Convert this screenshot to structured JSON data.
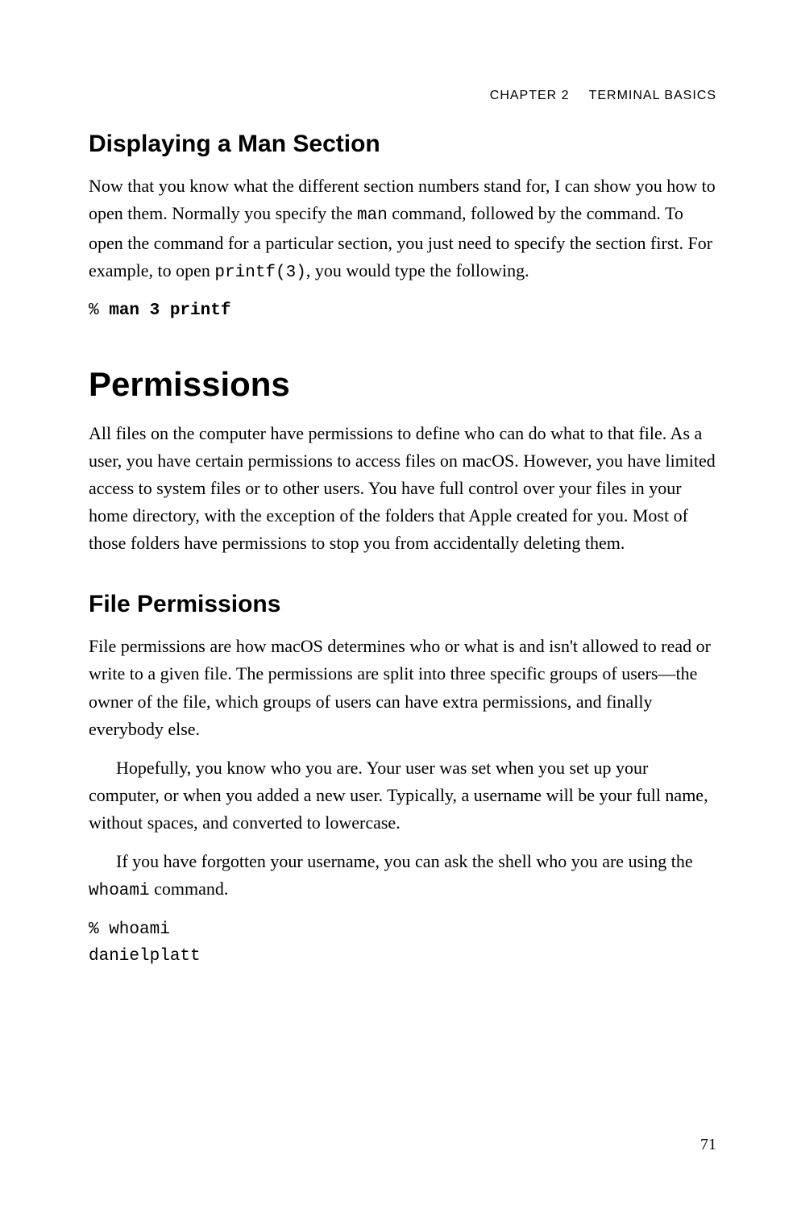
{
  "header": {
    "chapter": "CHAPTER 2",
    "title": "TERMINAL BASICS"
  },
  "section1": {
    "heading": "Displaying a Man Section",
    "p1_a": "Now that you know what the different section numbers stand for, I can show you how to open them. Normally you specify the ",
    "p1_code1": "man",
    "p1_b": " command, followed by the command. To open the command for a particular section, you just need to specify the section first. For example, to open ",
    "p1_code2": "printf(3)",
    "p1_c": ", you would type the following.",
    "code_prompt": "% ",
    "code_cmd": "man 3 printf"
  },
  "major": {
    "heading": "Permissions",
    "p1": "All files on the computer have permissions to define who can do what to that file. As a user, you have certain permissions to access files on macOS. However, you have limited access to system files or to other users. You have full control over your files in your home directory, with the exception of the folders that Apple created for you. Most of those folders have permissions to stop you from accidentally deleting them."
  },
  "section2": {
    "heading": "File Permissions",
    "p1": "File permissions are how macOS determines who or what is and isn't allowed to read or write to a given file. The permissions are split into three specific groups of users—the owner of the file, which groups of users can have extra permissions, and finally everybody else.",
    "p2": "Hopefully, you know who you are. Your user was set when you set up your computer, or when you added a new user. Typically, a username will be your full name, without spaces, and converted to lowercase.",
    "p3_a": "If you have forgotten your username, you can ask the shell who you are using the ",
    "p3_code": "whoami",
    "p3_b": " command.",
    "code_line1": "% whoami",
    "code_line2": "danielplatt"
  },
  "page_number": "71"
}
